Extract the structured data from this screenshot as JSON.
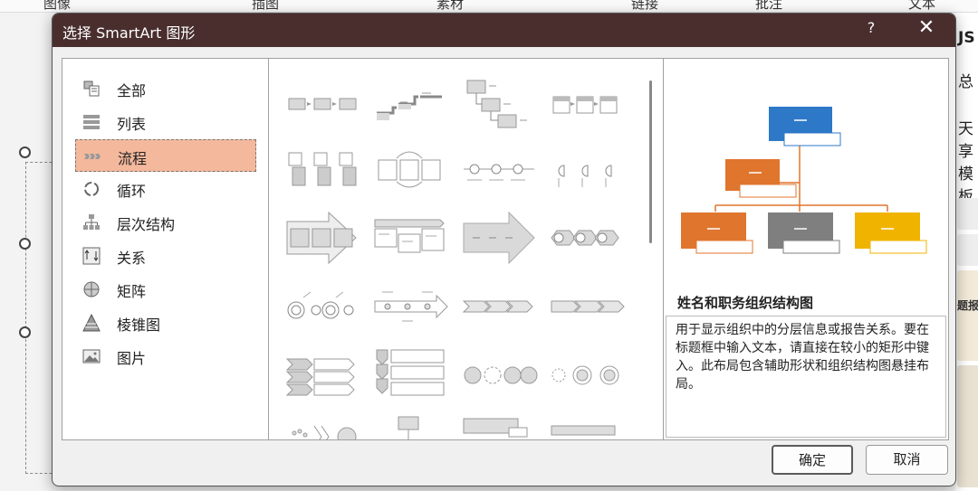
{
  "ribbon": {
    "tabs": [
      "图像",
      "插图",
      "素材",
      "链接",
      "批注",
      "文本"
    ]
  },
  "side_panel": {
    "t1": "JS",
    "t2": "总",
    "t3": "天享",
    "t4": "模板",
    "t5": "题报"
  },
  "dialog": {
    "title": "选择 SmartArt 图形",
    "help": "?",
    "close": "✕",
    "categories": [
      {
        "label": "全部",
        "icon": "all-icon"
      },
      {
        "label": "列表",
        "icon": "list-icon"
      },
      {
        "label": "流程",
        "icon": "process-icon",
        "selected": true
      },
      {
        "label": "循环",
        "icon": "cycle-icon"
      },
      {
        "label": "层次结构",
        "icon": "hierarchy-icon"
      },
      {
        "label": "关系",
        "icon": "relationship-icon"
      },
      {
        "label": "矩阵",
        "icon": "matrix-icon"
      },
      {
        "label": "棱锥图",
        "icon": "pyramid-icon"
      },
      {
        "label": "图片",
        "icon": "picture-icon"
      }
    ],
    "preview": {
      "name": "姓名和职务组织结构图",
      "description": "用于显示组织中的分层信息或报告关系。要在标题框中输入文本，请直接在较小的矩形中键入。此布局包含辅助形状和组织结构图悬挂布局。"
    },
    "ok_label": "确定",
    "cancel_label": "取消",
    "colors": {
      "titlebar": "#4a2e2e",
      "selected": "#f4b89c",
      "blue": "#2e78c8",
      "orange": "#e0752e",
      "gray": "#7f7f7f",
      "yellow": "#f0b400"
    }
  }
}
